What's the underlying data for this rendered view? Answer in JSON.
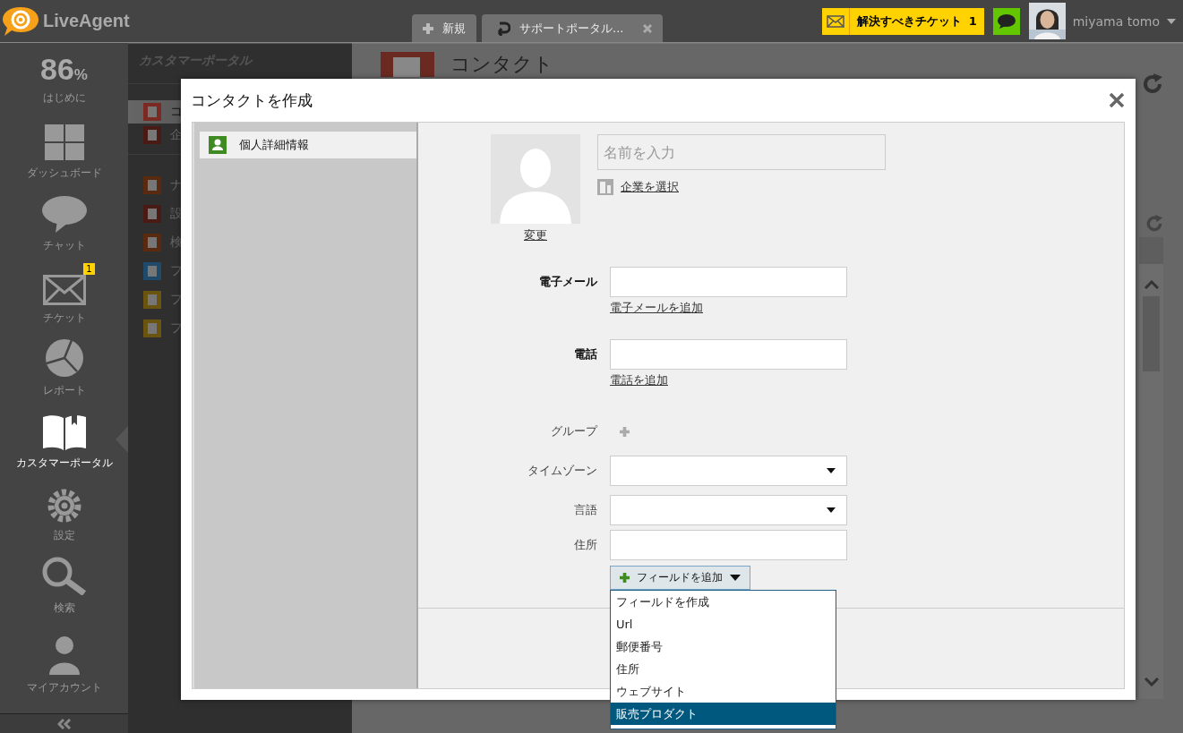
{
  "app": {
    "name": "LiveAgent"
  },
  "tabs": [
    {
      "label": "新規",
      "kind": "new"
    },
    {
      "label": "サポートポータル...",
      "kind": "page"
    }
  ],
  "tickets_button": {
    "label": "解決すべきチケット",
    "count": "1"
  },
  "user": {
    "name": "miyama tomo"
  },
  "sidebar": {
    "progress": {
      "value": "86",
      "unit": "%",
      "label": "はじめに"
    },
    "items": [
      {
        "label": "ダッシュボード",
        "kind": "dashboard",
        "selected": false
      },
      {
        "label": "チャット",
        "kind": "chat",
        "selected": false
      },
      {
        "label": "チケット",
        "kind": "ticket",
        "selected": false,
        "badge": "1"
      },
      {
        "label": "レポート",
        "kind": "report",
        "selected": false
      },
      {
        "label": "カスタマーポータル",
        "kind": "portal",
        "selected": true
      },
      {
        "label": "設定",
        "kind": "settings",
        "selected": false
      },
      {
        "label": "検索",
        "kind": "search",
        "selected": false
      },
      {
        "label": "マイアカウント",
        "kind": "account",
        "selected": false
      }
    ]
  },
  "portal_panel": {
    "title": "カスタマーポータル",
    "groups": [
      [
        {
          "label": "コ",
          "color": "#7a2a22",
          "selected": true
        },
        {
          "label": "企",
          "color": "#4a1a14",
          "selected": false
        }
      ],
      [
        {
          "label": "ナ",
          "color": "#5a2a10",
          "selected": false
        },
        {
          "label": "設",
          "color": "#4a1a14",
          "selected": false
        },
        {
          "label": "検",
          "color": "#5a2a10",
          "selected": false
        },
        {
          "label": "フ",
          "color": "#1f4a6a",
          "selected": false
        },
        {
          "label": "フ",
          "color": "#6a5410",
          "selected": false
        },
        {
          "label": "フ",
          "color": "#6a5410",
          "selected": false
        }
      ]
    ]
  },
  "page": {
    "title": "コンタクト"
  },
  "dialog": {
    "title": "コンタクトを作成",
    "sections": [
      {
        "label": "個人詳細情報",
        "selected": true
      }
    ],
    "name_placeholder": "名前を入力",
    "company_link": "企業を選択",
    "avatar_link": "変更",
    "fields": [
      {
        "kind": "contact",
        "label": "電子メール",
        "add_link": "電子メールを追加"
      },
      {
        "kind": "contact",
        "label": "電話",
        "add_link": "電話を追加"
      },
      {
        "kind": "add",
        "label": "グループ"
      },
      {
        "kind": "select",
        "label": "タイムゾーン"
      },
      {
        "kind": "select",
        "label": "言語"
      },
      {
        "kind": "input",
        "label": "住所"
      }
    ],
    "add_field_button": "フィールドを追加",
    "menu": [
      {
        "label": "フィールドを作成",
        "selected": false
      },
      {
        "label": "Url",
        "selected": false
      },
      {
        "label": "郵便番号",
        "selected": false
      },
      {
        "label": "住所",
        "selected": false
      },
      {
        "label": "ウェブサイト",
        "selected": false
      },
      {
        "label": "販売プロダクト",
        "selected": true
      }
    ]
  }
}
